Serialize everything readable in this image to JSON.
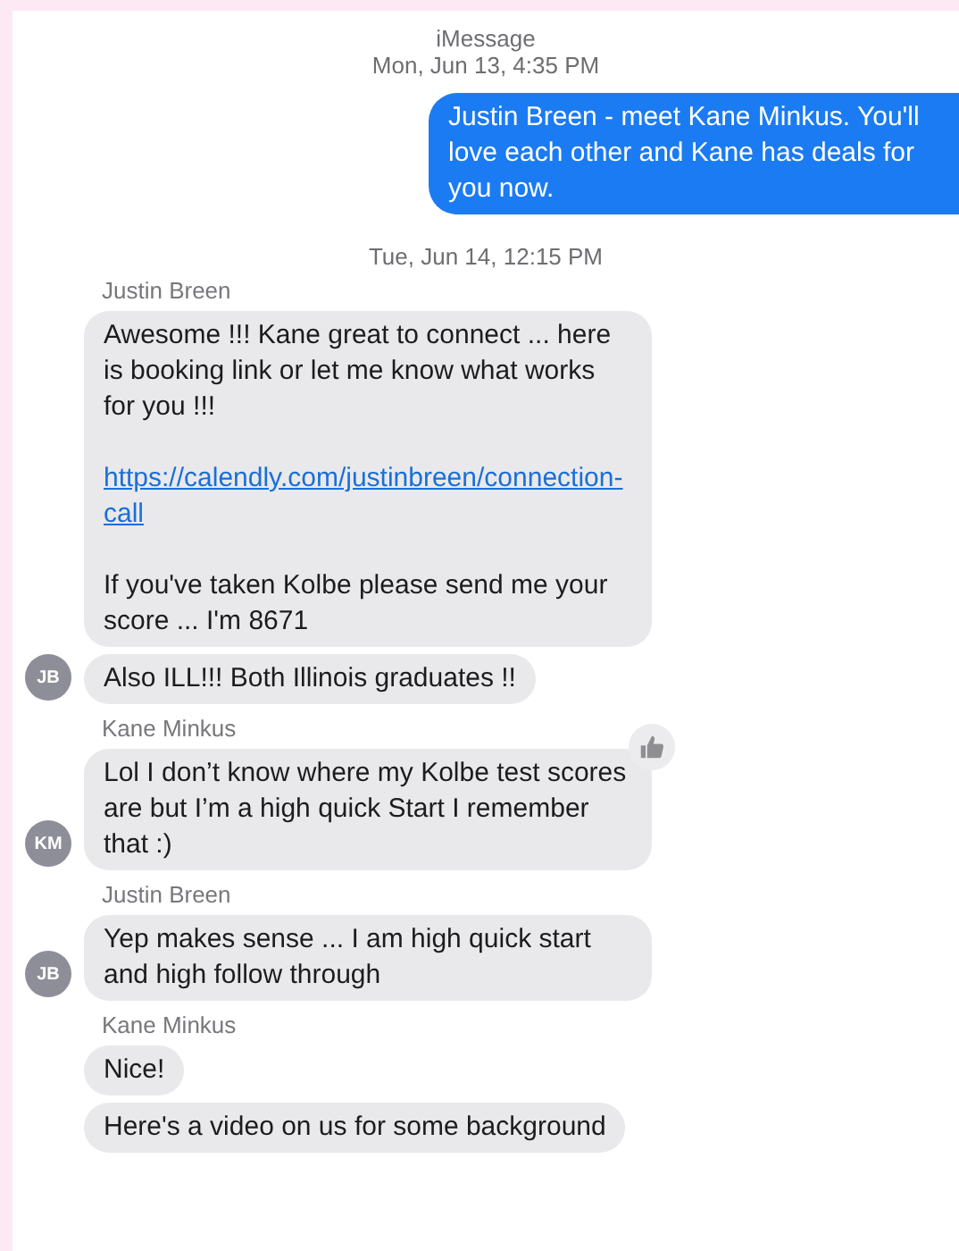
{
  "items": [
    {
      "kind": "timestamp",
      "service": "iMessage",
      "time": "Mon, Jun 13, 4:35 PM"
    },
    {
      "kind": "outgoing",
      "bubbles": [
        {
          "paragraphs": [
            {
              "kind": "text",
              "text": "Justin Breen - meet Kane Minkus. You'll love each other and Kane has deals for you now."
            }
          ]
        }
      ]
    },
    {
      "kind": "timestamp",
      "time": "Tue, Jun 14, 12:15 PM"
    },
    {
      "kind": "incoming",
      "sender": "Justin Breen",
      "avatar": "JB",
      "bubbles": [
        {
          "paragraphs": [
            {
              "kind": "text",
              "text": "Awesome !!! Kane great to connect ... here is booking link or let me know what works for you !!!"
            },
            {
              "kind": "link",
              "text": "https://calendly.com/justinbreen/connection-call"
            },
            {
              "kind": "text",
              "text": "If you've taken Kolbe please send me your score ... I'm 8671"
            }
          ]
        },
        {
          "paragraphs": [
            {
              "kind": "text",
              "text": "Also ILL!!! Both Illinois graduates !!"
            }
          ]
        }
      ]
    },
    {
      "kind": "incoming",
      "sender": "Kane Minkus",
      "avatar": "KM",
      "bubbles": [
        {
          "paragraphs": [
            {
              "kind": "text",
              "text": "Lol I don’t know where my Kolbe test scores are but I’m a high quick Start I remember that :)"
            }
          ],
          "reaction": true
        }
      ]
    },
    {
      "kind": "incoming",
      "sender": "Justin Breen",
      "avatar": "JB",
      "bubbles": [
        {
          "paragraphs": [
            {
              "kind": "text",
              "text": "Yep makes sense ... I am high quick start and high follow through"
            }
          ]
        }
      ]
    },
    {
      "kind": "incoming",
      "sender": "Kane Minkus",
      "bubbles": [
        {
          "paragraphs": [
            {
              "kind": "text",
              "text": "Nice!"
            }
          ]
        },
        {
          "paragraphs": [
            {
              "kind": "text",
              "text": "Here's a video on us for some background"
            }
          ]
        }
      ]
    }
  ]
}
